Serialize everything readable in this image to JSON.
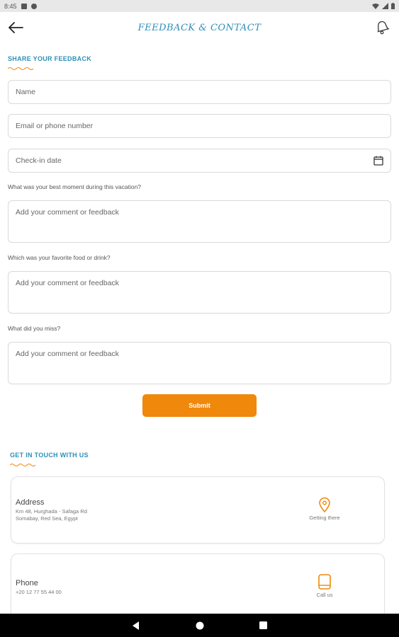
{
  "status_bar": {
    "time": "8:45"
  },
  "header": {
    "title": "FEEDBACK & CONTACT"
  },
  "feedback": {
    "section_title": "SHARE YOUR FEEDBACK",
    "name_placeholder": "Name",
    "email_placeholder": "Email or phone number",
    "checkin_placeholder": "Check-in date",
    "q1_label": "What was your best moment during this vacation?",
    "q1_placeholder": "Add your comment or feedback",
    "q2_label": "Which was your favorite food or drink?",
    "q2_placeholder": "Add your comment or feedback",
    "q3_label": "What did you miss?",
    "q3_placeholder": "Add your comment or feedback",
    "submit_label": "Submit"
  },
  "contact": {
    "section_title": "GET IN TOUCH WITH US",
    "address": {
      "label": "Address",
      "line1": "Km 48, Hurghada - Safaga Rd",
      "line2": "Somabay, Red Sea, Egypt",
      "action_label": "Getting there",
      "icon": "location-pin-icon"
    },
    "phone": {
      "label": "Phone",
      "number": "+20 12 77 55 44 00",
      "action_label": "Call us",
      "icon": "phone-icon"
    }
  },
  "colors": {
    "accent": "#f0880b",
    "title_blue": "#2e8fb8",
    "field_border": "#d9d9d9"
  }
}
